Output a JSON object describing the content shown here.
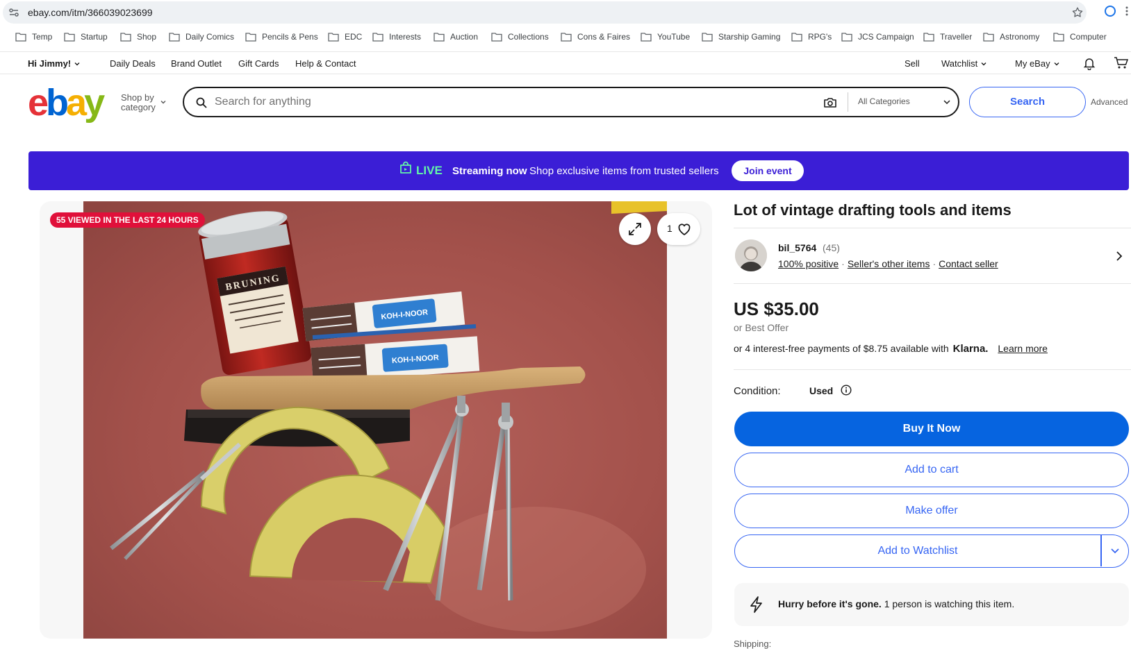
{
  "browser": {
    "url": "ebay.com/itm/366039023699",
    "bookmarks": [
      "Temp",
      "Startup",
      "Shop",
      "Daily Comics",
      "Pencils & Pens",
      "EDC",
      "Interests",
      "Auction",
      "Collections",
      "Cons & Faires",
      "YouTube",
      "Starship Gaming",
      "RPG's",
      "JCS Campaign",
      "Traveller",
      "Astronomy",
      "Computer"
    ]
  },
  "topnav": {
    "greeting": "Hi Jimmy!",
    "daily_deals": "Daily Deals",
    "brand_outlet": "Brand Outlet",
    "gift_cards": "Gift Cards",
    "help": "Help & Contact",
    "sell": "Sell",
    "watchlist": "Watchlist",
    "my_ebay": "My eBay"
  },
  "header": {
    "logo": [
      "e",
      "b",
      "a",
      "y"
    ],
    "logo_colors": [
      "#e53238",
      "#0064d2",
      "#f5af02",
      "#86b817"
    ],
    "shop_by_1": "Shop by",
    "shop_by_2": "category",
    "search_placeholder": "Search for anything",
    "category": "All Categories",
    "search_button": "Search",
    "advanced": "Advanced"
  },
  "banner": {
    "live": "LIVE",
    "streaming": "Streaming now",
    "description": "Shop exclusive items from trusted sellers",
    "join": "Join event"
  },
  "gallery": {
    "viewed_badge": "55 VIEWED IN THE LAST 24 HOURS",
    "watch_count": "1"
  },
  "item": {
    "title": "Lot of vintage drafting tools and items",
    "seller": {
      "name": "bil_5764",
      "score": "(45)",
      "positive": "100% positive",
      "other_items": "Seller's other items",
      "contact": "Contact seller"
    },
    "price": "US $35.00",
    "best_offer": "or Best Offer",
    "installments": "or 4 interest-free payments of $8.75 available with",
    "klarna": "Klarna.",
    "learn_more": "Learn more",
    "condition_label": "Condition:",
    "condition_value": "Used",
    "buy_now": "Buy It Now",
    "add_to_cart": "Add to cart",
    "make_offer": "Make offer",
    "add_to_watchlist": "Add to Watchlist",
    "hurry_bold": "Hurry before it's gone.",
    "hurry_rest": " 1 person is watching this item.",
    "shipping_peek": "Shipping:"
  },
  "colors": {
    "banner_bg": "#3b1ed6",
    "live_green": "#63f5a8",
    "primary_blue": "#3665f3",
    "badge_red": "#e0103a"
  }
}
